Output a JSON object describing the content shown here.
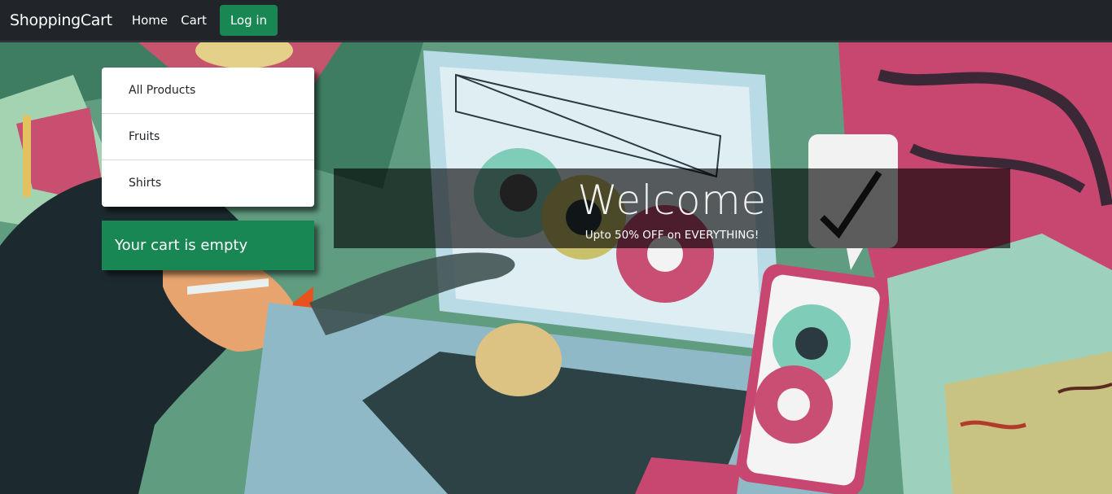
{
  "navbar": {
    "brand": "ShoppingCart",
    "links": [
      "Home",
      "Cart"
    ],
    "login_label": "Log in",
    "login_color": "#198754"
  },
  "categories": [
    "All Products",
    "Fruits",
    "Shirts"
  ],
  "cart": {
    "status": "Your cart is empty"
  },
  "hero": {
    "title": "Welcome",
    "subtitle": "Upto 50% OFF on EVERYTHING!"
  },
  "colors": {
    "navbar_bg": "#212529",
    "accent": "#198754"
  }
}
